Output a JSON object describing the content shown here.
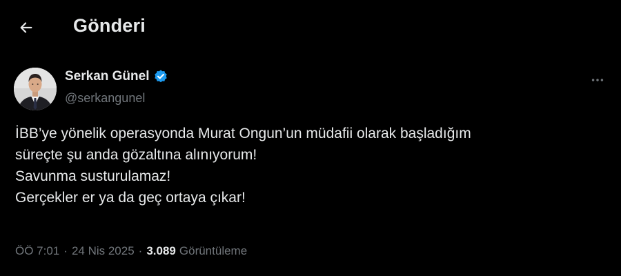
{
  "header": {
    "title": "Gönderi",
    "back_icon": "arrow-left-icon"
  },
  "author": {
    "display_name": "Serkan Günel",
    "handle": "@serkangunel",
    "verified": true,
    "verified_color": "#1d9bf0"
  },
  "tweet": {
    "lines": [
      "İBB’ye yönelik operasyonda Murat Ongun’un müdafii olarak başladığım",
      "süreçte şu anda gözaltına alınıyorum!",
      "Savunma susturulamaz!",
      "Gerçekler er ya da geç ortaya çıkar!"
    ]
  },
  "meta": {
    "time": "ÖÖ 7:01",
    "separator": "·",
    "date": "24 Nis 2025",
    "views_count": "3.089",
    "views_label": "Görüntüleme"
  },
  "colors": {
    "background": "#000000",
    "text_primary": "#e7e9ea",
    "text_secondary": "#71767b",
    "accent": "#1d9bf0"
  }
}
